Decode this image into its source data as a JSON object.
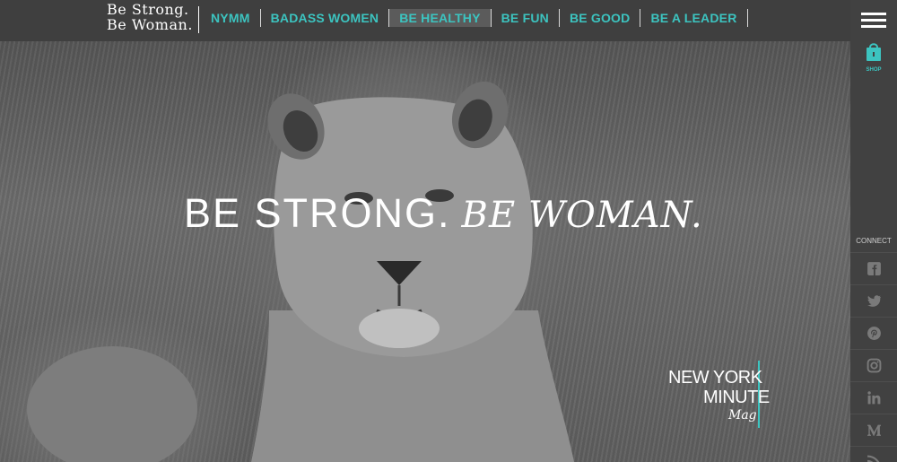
{
  "brand": {
    "logo_line1": "Be Strong.",
    "logo_line2": "Be Woman."
  },
  "nav": {
    "items": [
      {
        "label": "NYMM"
      },
      {
        "label": "BADASS WOMEN"
      },
      {
        "label": "BE HEALTHY",
        "active": true
      },
      {
        "label": "BE FUN"
      },
      {
        "label": "BE GOOD"
      },
      {
        "label": "BE A LEADER"
      }
    ]
  },
  "hero": {
    "title_part1": "BE STRONG.",
    "title_part2": "BE WOMAN.",
    "nymm_line1": "NEW YORK",
    "nymm_line2": "MINUTE",
    "nymm_line3": "Mag"
  },
  "sidebar": {
    "shop_label": "SHOP",
    "connect_label": "CONNECT",
    "socials": [
      "facebook-icon",
      "twitter-icon",
      "pinterest-icon",
      "instagram-icon",
      "linkedin-icon",
      "medium-icon",
      "rss-icon"
    ]
  },
  "colors": {
    "accent": "#3cc4c0",
    "topbar": "#3f3f3f",
    "sidebar": "#414141",
    "text": "#ffffff",
    "icon": "#7a7a7a"
  }
}
